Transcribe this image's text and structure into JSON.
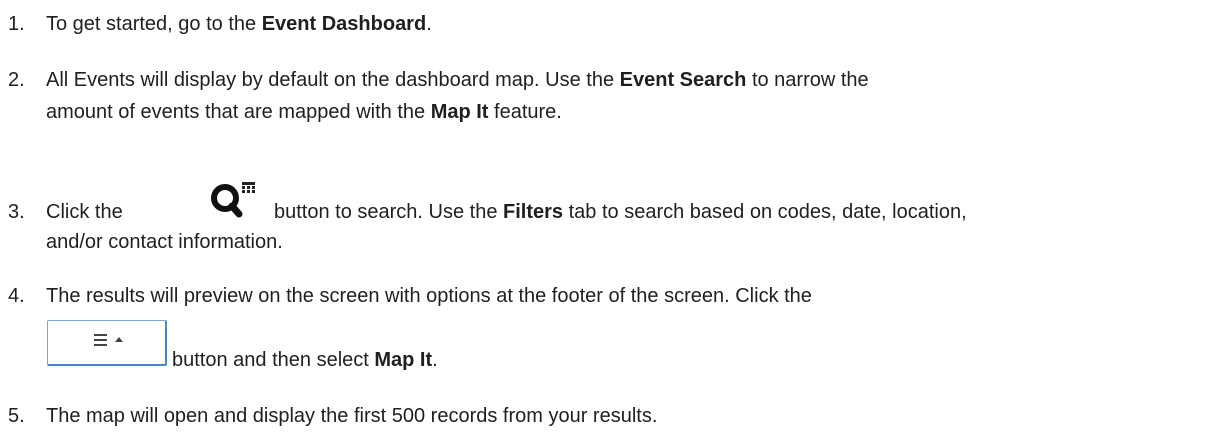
{
  "steps": [
    {
      "number": "1.",
      "parts": [
        "To get started, go to the ",
        "Event Dashboard",
        "."
      ]
    },
    {
      "number": "2.",
      "line1": [
        "All Events will display by default on the dashboard map. Use the ",
        "Event Search",
        " to narrow the"
      ],
      "line2": [
        "amount of events that are mapped with the ",
        "Map It",
        " feature."
      ]
    },
    {
      "number": "3.",
      "line1": [
        "Click the",
        "button to search.  Use the ",
        "Filters",
        " tab to search based on codes, date, location,"
      ],
      "line2": "and/or contact information.",
      "icon": "search-calendar-icon"
    },
    {
      "number": "4.",
      "line1": "The results will preview on the screen with options at the footer of the screen. Click the",
      "line2": [
        "button and then select ",
        "Map It",
        "."
      ],
      "icon": "menu-caret-button"
    },
    {
      "number": "5.",
      "text": "The map will open and display the first 500 records from your results."
    }
  ]
}
